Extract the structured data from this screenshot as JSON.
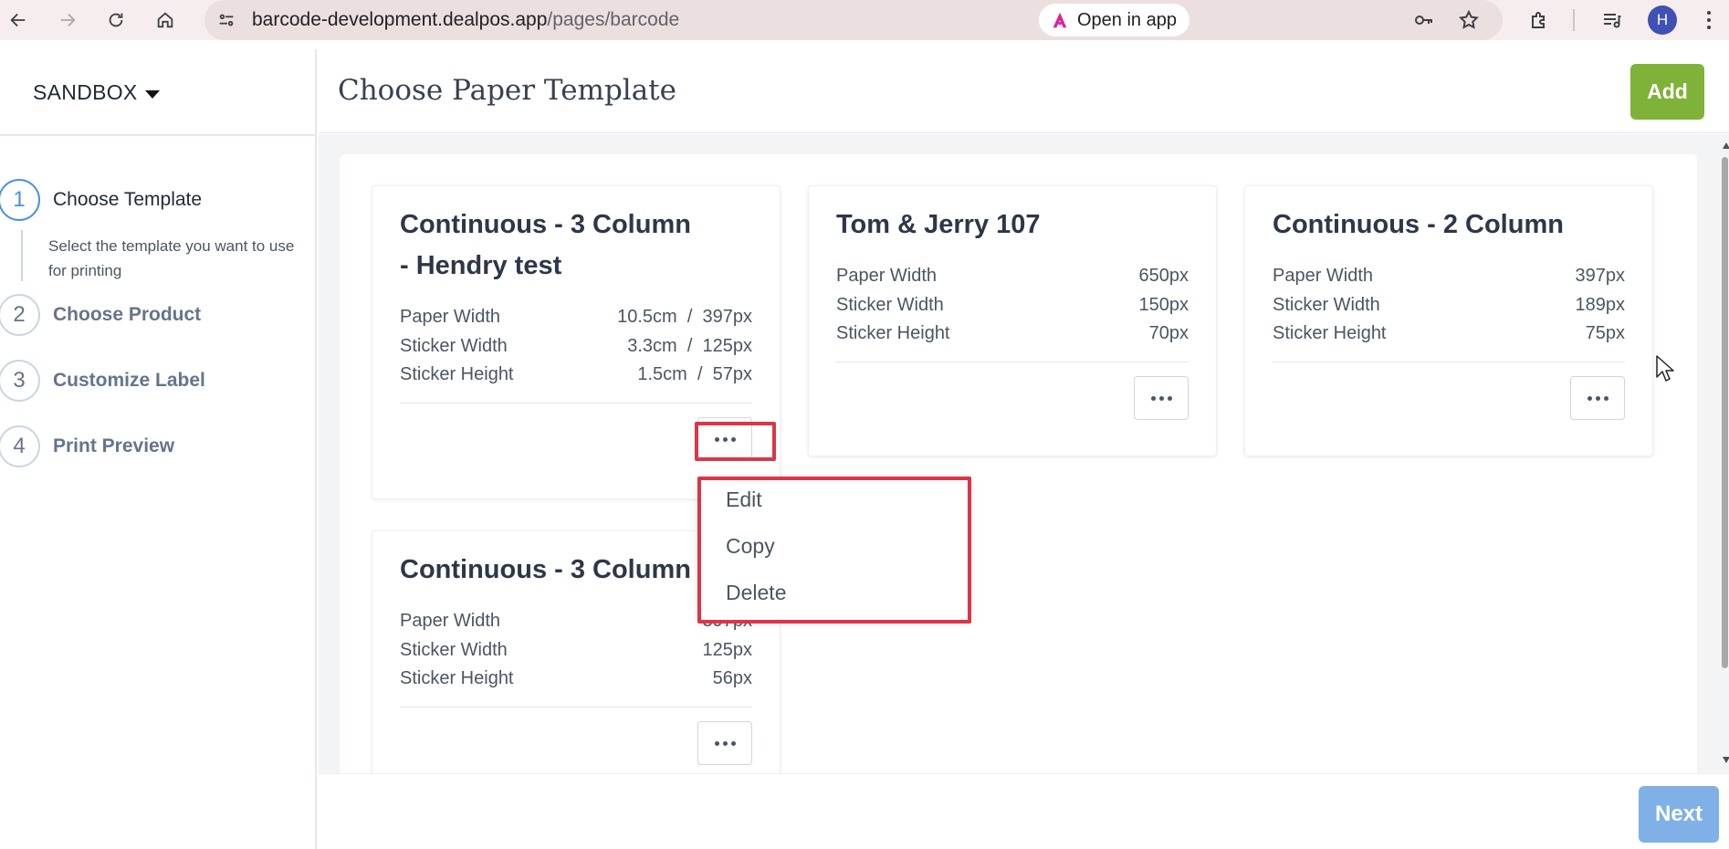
{
  "browser": {
    "url_domain": "barcode-development.dealpos.app",
    "url_path": "/pages/barcode",
    "open_in_app_label": "Open in app",
    "profile_initial": "H"
  },
  "sidebar": {
    "brand": "SANDBOX",
    "steps": [
      {
        "number": "1",
        "label": "Choose Template",
        "description": "Select the template you want to use for printing",
        "active": true
      },
      {
        "number": "2",
        "label": "Choose Product",
        "active": false
      },
      {
        "number": "3",
        "label": "Customize Label",
        "active": false
      },
      {
        "number": "4",
        "label": "Print Preview",
        "active": false
      }
    ]
  },
  "header": {
    "title": "Choose Paper Template",
    "add_label": "Add"
  },
  "templates": [
    {
      "title_line1": "Continuous - 3 Column",
      "title_line2": "- Hendry test",
      "specs": [
        {
          "label": "Paper Width",
          "value": "10.5cm  /  397px"
        },
        {
          "label": "Sticker Width",
          "value": "3.3cm  /  125px"
        },
        {
          "label": "Sticker Height",
          "value": "1.5cm  /  57px"
        }
      ]
    },
    {
      "title_line1": "Tom & Jerry 107",
      "specs": [
        {
          "label": "Paper Width",
          "value": "650px"
        },
        {
          "label": "Sticker Width",
          "value": "150px"
        },
        {
          "label": "Sticker Height",
          "value": "70px"
        }
      ]
    },
    {
      "title_line1": "Continuous - 2 Column",
      "specs": [
        {
          "label": "Paper Width",
          "value": "397px"
        },
        {
          "label": "Sticker Width",
          "value": "189px"
        },
        {
          "label": "Sticker Height",
          "value": "75px"
        }
      ]
    },
    {
      "title_line1": "Continuous - 3 Column",
      "specs": [
        {
          "label": "Paper Width",
          "value": "397px"
        },
        {
          "label": "Sticker Width",
          "value": "125px"
        },
        {
          "label": "Sticker Height",
          "value": "56px"
        }
      ]
    }
  ],
  "dropdown": {
    "items": [
      "Edit",
      "Copy",
      "Delete"
    ]
  },
  "footer": {
    "next_label": "Next"
  },
  "colors": {
    "add_button": "#7fb238",
    "next_button": "#7fb0e6",
    "active_step": "#4a90e2",
    "highlight": "#dc3545"
  }
}
